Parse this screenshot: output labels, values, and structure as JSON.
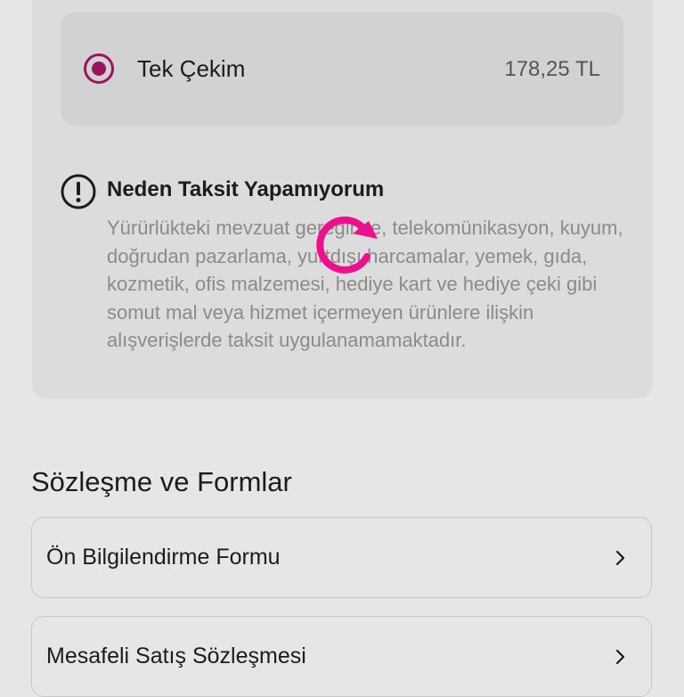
{
  "payment": {
    "option_label": "Tek Çekim",
    "option_price": "178,25 TL",
    "selected": true
  },
  "installment_info": {
    "title": "Neden Taksit Yapamıyorum",
    "body": "Yürürlükteki mevzuat gereğince, telekomünikasyon, kuyum, doğrudan pazarlama, yurtdışı harcamalar, yemek, gıda, kozmetik, ofis malzemesi, hediye kart ve hediye çeki gibi somut mal veya hizmet içermeyen ürünlere ilişkin alışverişlerde taksit uygulanamamaktadır."
  },
  "agreements": {
    "title": "Sözleşme ve Formlar",
    "items": [
      {
        "label": "Ön Bilgilendirme Formu"
      },
      {
        "label": "Mesafeli Satış Sözleşmesi"
      }
    ]
  },
  "colors": {
    "accent": "#9a1561",
    "spinner": "#ee0f8f",
    "overlay_background": "#e6e6e6"
  },
  "icons": {
    "warning": "exclamation-circle-icon",
    "chevron": "chevron-right-icon",
    "loading": "refresh-spinner-icon"
  }
}
